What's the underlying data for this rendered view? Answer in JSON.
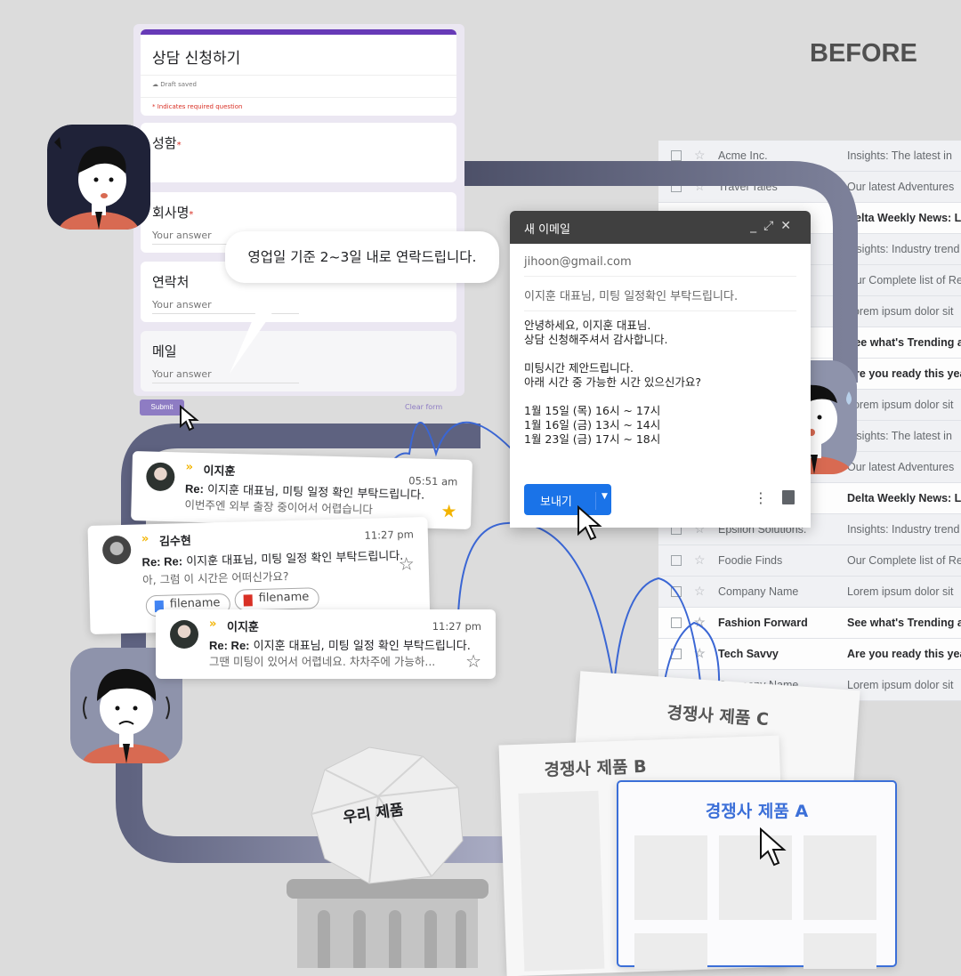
{
  "badge": "BEFORE",
  "form": {
    "title": "상담 신청하기",
    "draft": "Draft saved",
    "required_note": "* Indicates required question",
    "fields": [
      {
        "label": "성함",
        "required": true,
        "placeholder": ""
      },
      {
        "label": "회사명",
        "required": true,
        "placeholder": "Your answer"
      },
      {
        "label": "연락처",
        "required": false,
        "placeholder": "Your answer"
      },
      {
        "label": "메일",
        "required": false,
        "placeholder": "Your answer"
      }
    ],
    "required_mark": "*",
    "submit": "Submit",
    "clear": "Clear form",
    "accent": "#673ab7"
  },
  "bubble": "영업일 기준 2~3일 내로 연락드립니다.",
  "compose": {
    "title": "새 이메일",
    "to": "jihoon@gmail.com",
    "subject": "이지훈 대표님, 미팅 일정확인 부탁드립니다.",
    "body": "안녕하세요, 이지훈 대표님.\n상담 신청해주셔서 감사합니다.\n\n미팅시간 제안드립니다.\n아래 시간 중 가능한 시간 있으신가요?\n\n1월 15일 (목) 16시 ~ 17시\n1월 16일 (금) 13시 ~ 14시\n1월 23일 (금) 17시 ~ 18시",
    "send": "보내기",
    "send_color": "#1a73e8"
  },
  "inbox": [
    {
      "sender": "Acme Inc.",
      "subject": "Insights: The latest in",
      "bold": false
    },
    {
      "sender": "Travel Tales",
      "subject": "Our latest Adventures",
      "bold": false
    },
    {
      "sender": "",
      "subject": "Delta Weekly News: Le",
      "bold": true
    },
    {
      "sender": "",
      "subject": "Insights: Industry trend",
      "bold": false
    },
    {
      "sender": "",
      "subject": "Our Complete list of Re",
      "bold": false
    },
    {
      "sender": "",
      "subject": "Lorem ipsum dolor sit",
      "bold": false
    },
    {
      "sender": "",
      "subject": "See what's Trending at",
      "bold": true
    },
    {
      "sender": "",
      "subject": "Are you ready this year",
      "bold": true
    },
    {
      "sender": "",
      "subject": "Lorem ipsum dolor sit",
      "bold": false
    },
    {
      "sender": "",
      "subject": "Insights: The latest in",
      "bold": false
    },
    {
      "sender": "",
      "subject": "Our latest Adventures",
      "bold": false
    },
    {
      "sender": "",
      "subject": "Delta Weekly News: Le",
      "bold": true
    },
    {
      "sender": "Epsilon Solutions.",
      "subject": "Insights: Industry trend",
      "bold": false
    },
    {
      "sender": "Foodie Finds",
      "subject": "Our Complete list of Re",
      "bold": false
    },
    {
      "sender": "Company Name",
      "subject": "Lorem ipsum dolor sit",
      "bold": false
    },
    {
      "sender": "Fashion Forward",
      "subject": "See what's Trending at",
      "bold": true
    },
    {
      "sender": "Tech Savvy",
      "subject": "Are you ready this year",
      "bold": true
    },
    {
      "sender": "Company Name",
      "subject": "Lorem ipsum dolor sit",
      "bold": false
    }
  ],
  "mails": [
    {
      "name": "이지훈",
      "time": "05:51 am",
      "subject_prefix": "Re:",
      "subject": "이지훈 대표님, 미팅 일정 확인 부탁드립니다.",
      "preview": "이번주엔 외부 출장 중이어서 어렵습니다",
      "starred": true
    },
    {
      "name": "김수현",
      "time": "11:27 pm",
      "subject_prefix": "Re: Re:",
      "subject": "이지훈 대표님, 미팅 일정 확인 부탁드립니다.",
      "preview": "아, 그럼 이 시간은 어떠신가요?",
      "starred": false,
      "attachments": [
        "filename",
        "filename"
      ]
    },
    {
      "name": "이지훈",
      "time": "11:27 pm",
      "subject_prefix": "Re: Re:",
      "subject": "이지훈 대표님, 미팅 일정 확인 부탁드립니다.",
      "preview": "그땐 미팅이 있어서 어렵네요. 차차주에 가능하...",
      "starred": false
    }
  ],
  "mail_arrows": "»",
  "products": {
    "ours": "우리 제품",
    "c": "경쟁사 제품 C",
    "b": "경쟁사 제품 B",
    "a": "경쟁사 제품 A",
    "highlight": "#3b6fd8"
  }
}
